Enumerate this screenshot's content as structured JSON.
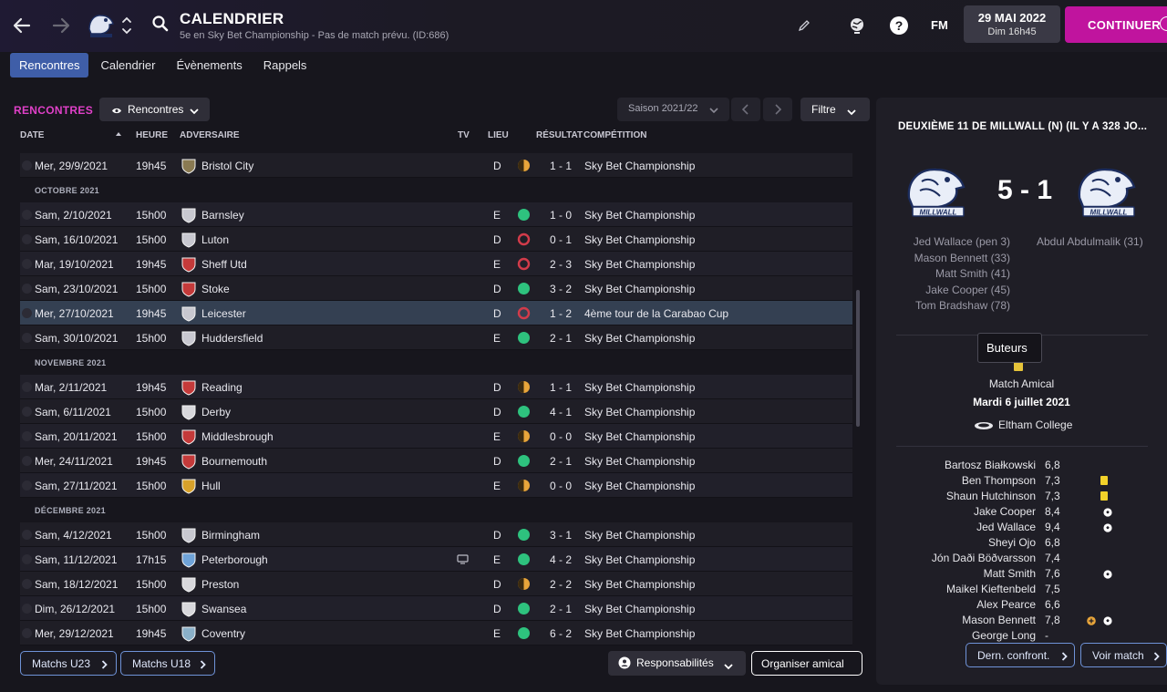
{
  "header": {
    "title": "CALENDRIER",
    "subtitle": "5e en Sky Bet Championship - Pas de match prévu. (ID:686)",
    "fm_label": "FM",
    "date_main": "29 MAI 2022",
    "date_sub": "Dim 16h45",
    "continue_label": "CONTINUER"
  },
  "tabs": [
    "Rencontres",
    "Calendrier",
    "Évènements",
    "Rappels"
  ],
  "list": {
    "section_title": "RENCONTRES",
    "view_label": "Rencontres",
    "season_label": "Saison 2021/22",
    "filter_label": "Filtre",
    "columns": {
      "date": "DATE",
      "time": "HEURE",
      "opponent": "ADVERSAIRE",
      "tv": "TV",
      "venue": "LIEU",
      "result": "RÉSULTAT",
      "competition": "COMPÉTITION"
    }
  },
  "rows": [
    {
      "kind": "match",
      "date": "Mer, 29/9/2021",
      "time": "19h45",
      "opponent": "Bristol City",
      "crest": "#8a7a52",
      "tv": false,
      "venue": "D",
      "res": "draw",
      "score": "1 - 1",
      "comp": "Sky Bet Championship"
    },
    {
      "kind": "month",
      "label": "OCTOBRE 2021"
    },
    {
      "kind": "match",
      "date": "Sam, 2/10/2021",
      "time": "15h00",
      "opponent": "Barnsley",
      "crest": "#c8c8d0",
      "tv": false,
      "venue": "E",
      "res": "win",
      "score": "1 - 0",
      "comp": "Sky Bet Championship"
    },
    {
      "kind": "match",
      "date": "Sam, 16/10/2021",
      "time": "15h00",
      "opponent": "Luton",
      "crest": "#c8c8d0",
      "tv": false,
      "venue": "D",
      "res": "loss",
      "score": "0 - 1",
      "comp": "Sky Bet Championship"
    },
    {
      "kind": "match",
      "date": "Mar, 19/10/2021",
      "time": "19h45",
      "opponent": "Sheff Utd",
      "crest": "#c43a3a",
      "tv": false,
      "venue": "E",
      "res": "loss",
      "score": "2 - 3",
      "comp": "Sky Bet Championship"
    },
    {
      "kind": "match",
      "date": "Sam, 23/10/2021",
      "time": "15h00",
      "opponent": "Stoke",
      "crest": "#c43a3a",
      "tv": false,
      "venue": "D",
      "res": "win",
      "score": "3 - 2",
      "comp": "Sky Bet Championship"
    },
    {
      "kind": "match",
      "date": "Mer, 27/10/2021",
      "time": "19h45",
      "opponent": "Leicester",
      "crest": "#c8c8d0",
      "tv": false,
      "venue": "D",
      "res": "loss",
      "score": "1 - 2",
      "comp": "4ème tour de la Carabao Cup",
      "selected": true
    },
    {
      "kind": "match",
      "date": "Sam, 30/10/2021",
      "time": "15h00",
      "opponent": "Huddersfield",
      "crest": "#c8c8d0",
      "tv": false,
      "venue": "E",
      "res": "win",
      "score": "2 - 1",
      "comp": "Sky Bet Championship"
    },
    {
      "kind": "month",
      "label": "NOVEMBRE 2021"
    },
    {
      "kind": "match",
      "date": "Mar, 2/11/2021",
      "time": "19h45",
      "opponent": "Reading",
      "crest": "#c43a3a",
      "tv": false,
      "venue": "D",
      "res": "draw",
      "score": "1 - 1",
      "comp": "Sky Bet Championship"
    },
    {
      "kind": "match",
      "date": "Sam, 6/11/2021",
      "time": "15h00",
      "opponent": "Derby",
      "crest": "#d8d8dc",
      "tv": false,
      "venue": "D",
      "res": "win",
      "score": "4 - 1",
      "comp": "Sky Bet Championship"
    },
    {
      "kind": "match",
      "date": "Sam, 20/11/2021",
      "time": "15h00",
      "opponent": "Middlesbrough",
      "crest": "#c43a3a",
      "tv": false,
      "venue": "E",
      "res": "draw",
      "score": "0 - 0",
      "comp": "Sky Bet Championship"
    },
    {
      "kind": "match",
      "date": "Mer, 24/11/2021",
      "time": "19h45",
      "opponent": "Bournemouth",
      "crest": "#c43a3a",
      "tv": false,
      "venue": "D",
      "res": "win",
      "score": "2 - 1",
      "comp": "Sky Bet Championship"
    },
    {
      "kind": "match",
      "date": "Sam, 27/11/2021",
      "time": "15h00",
      "opponent": "Hull",
      "crest": "#d8a12a",
      "tv": false,
      "venue": "E",
      "res": "draw",
      "score": "0 - 0",
      "comp": "Sky Bet Championship"
    },
    {
      "kind": "month",
      "label": "DÉCEMBRE 2021"
    },
    {
      "kind": "match",
      "date": "Sam, 4/12/2021",
      "time": "15h00",
      "opponent": "Birmingham",
      "crest": "#c8c8d0",
      "tv": false,
      "venue": "D",
      "res": "win",
      "score": "3 - 1",
      "comp": "Sky Bet Championship"
    },
    {
      "kind": "match",
      "date": "Sam, 11/12/2021",
      "time": "17h15",
      "opponent": "Peterborough",
      "crest": "#6fa3d8",
      "tv": true,
      "venue": "E",
      "res": "win",
      "score": "4 - 2",
      "comp": "Sky Bet Championship"
    },
    {
      "kind": "match",
      "date": "Sam, 18/12/2021",
      "time": "15h00",
      "opponent": "Preston",
      "crest": "#d8d8dc",
      "tv": false,
      "venue": "D",
      "res": "draw",
      "score": "2 - 2",
      "comp": "Sky Bet Championship"
    },
    {
      "kind": "match",
      "date": "Dim, 26/12/2021",
      "time": "15h00",
      "opponent": "Swansea",
      "crest": "#d8d8dc",
      "tv": false,
      "venue": "D",
      "res": "win",
      "score": "2 - 1",
      "comp": "Sky Bet Championship"
    },
    {
      "kind": "match",
      "date": "Mer, 29/12/2021",
      "time": "19h45",
      "opponent": "Coventry",
      "crest": "#8ab0c8",
      "tv": false,
      "venue": "E",
      "res": "win",
      "score": "6 - 2",
      "comp": "Sky Bet Championship"
    }
  ],
  "footer": {
    "u23_label": "Matchs U23",
    "u18_label": "Matchs U18",
    "resp_label": "Responsabilités",
    "amical_label": "Organiser amical"
  },
  "detail": {
    "title": "DEUXIÈME 11 DE MILLWALL (N) (IL Y A 328 JO...",
    "score": "5 - 1",
    "home_scorers": [
      "Jed Wallace (pen 3)",
      "Mason Bennett (33)",
      "Matt Smith (41)",
      "Jake Cooper (45)",
      "Tom Bradshaw (78)"
    ],
    "away_scorers": [
      "Abdul Abdulmalik (31)"
    ],
    "tooltip": "Buteurs",
    "match_type": "Match Amical",
    "match_date": "Mardi 6 juillet 2021",
    "venue": "Eltham College",
    "ratings": [
      {
        "name": "Bartosz Białkowski",
        "rating": "6,8",
        "events": []
      },
      {
        "name": "Ben Thompson",
        "rating": "7,3",
        "events": [
          "yellow-card"
        ]
      },
      {
        "name": "Shaun Hutchinson",
        "rating": "7,3",
        "events": [
          "yellow-card"
        ]
      },
      {
        "name": "Jake Cooper",
        "rating": "8,4",
        "events": [
          "goal"
        ]
      },
      {
        "name": "Jed Wallace",
        "rating": "9,4",
        "events": [
          "goal"
        ]
      },
      {
        "name": "Sheyi Ojo",
        "rating": "6,8",
        "events": []
      },
      {
        "name": "Jón Daði Böðvarsson",
        "rating": "7,4",
        "events": []
      },
      {
        "name": "Matt Smith",
        "rating": "7,6",
        "events": [
          "goal"
        ]
      },
      {
        "name": "Maikel Kieftenbeld",
        "rating": "7,5",
        "events": []
      },
      {
        "name": "Alex Pearce",
        "rating": "6,6",
        "events": []
      },
      {
        "name": "Mason Bennett",
        "rating": "7,8",
        "events": [
          "assist",
          "goal"
        ]
      },
      {
        "name": "George Long",
        "rating": "-",
        "events": []
      }
    ],
    "last_meetings_label": "Dern. confront.",
    "view_match_label": "Voir match"
  },
  "colors": {
    "accent_magenta": "#c0149e",
    "section_title": "#e040c8",
    "win": "#2ec27e",
    "draw": "#e8a53a",
    "loss": "#d23b4a",
    "tab_active": "#3f5ea8",
    "button_border": "#6f93d8"
  }
}
